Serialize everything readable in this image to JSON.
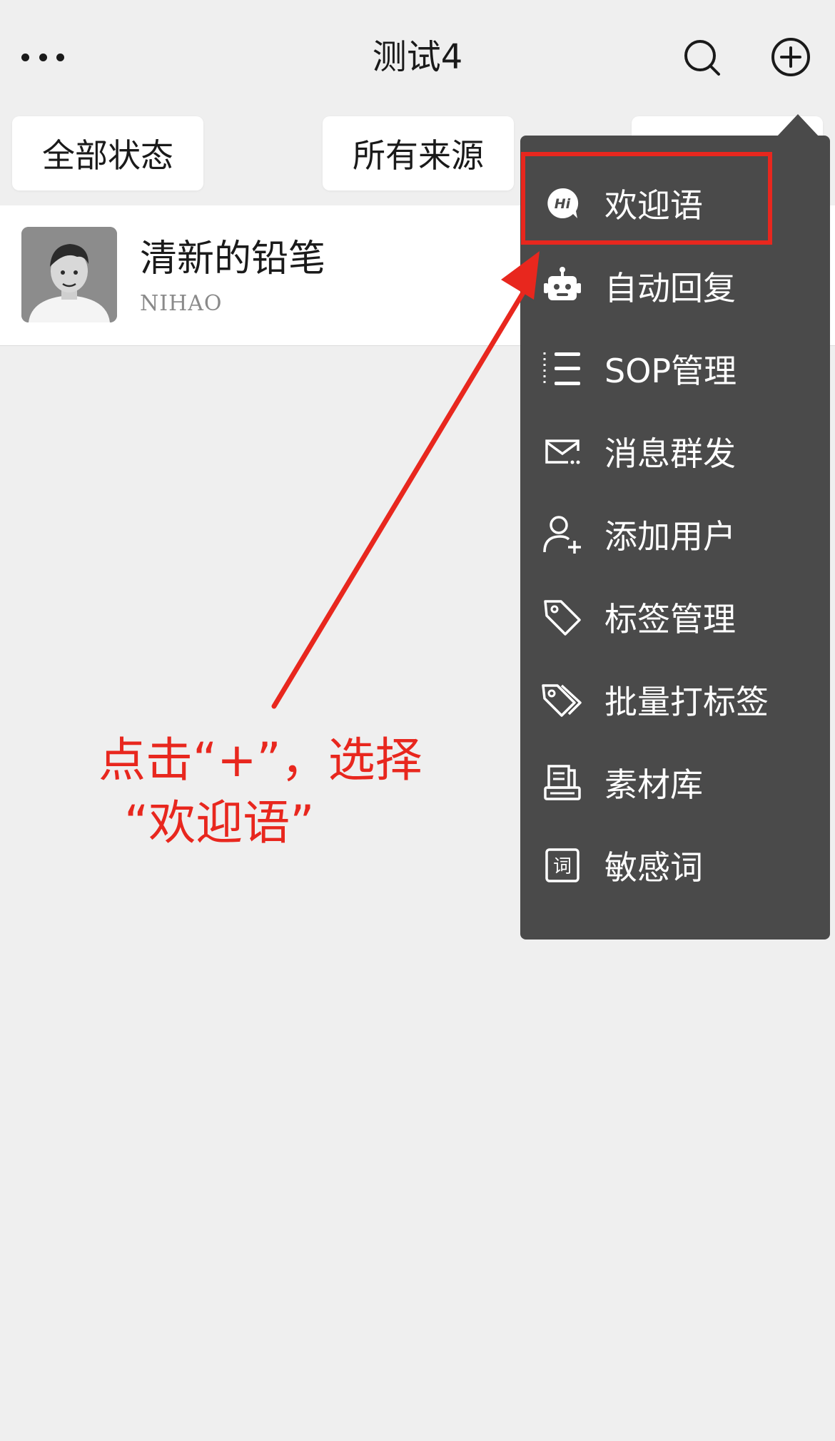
{
  "header": {
    "title": "测试4",
    "more_icon": "more-dots-icon",
    "search_icon": "search-icon",
    "add_icon": "plus-circle-icon"
  },
  "filters": [
    "全部状态",
    "所有来源",
    ""
  ],
  "contact": {
    "name": "清新的铅笔",
    "subtitle": "NIHAO",
    "avatar_icon": "avatar"
  },
  "menu": {
    "items": [
      {
        "label": "欢迎语",
        "icon": "hi-bubble-icon"
      },
      {
        "label": "自动回复",
        "icon": "robot-icon"
      },
      {
        "label": "SOP管理",
        "icon": "list-icon"
      },
      {
        "label": "消息群发",
        "icon": "mail-broadcast-icon"
      },
      {
        "label": "添加用户",
        "icon": "add-user-icon"
      },
      {
        "label": "标签管理",
        "icon": "tag-icon"
      },
      {
        "label": "批量打标签",
        "icon": "multi-tag-icon"
      },
      {
        "label": "素材库",
        "icon": "material-library-icon"
      },
      {
        "label": "敏感词",
        "icon": "sensitive-word-icon"
      }
    ]
  },
  "annotation": {
    "line1": "点击“+”，选择",
    "line2": "“欢迎语”",
    "color": "#e8271e"
  },
  "colors": {
    "menu_bg": "#4a4a4a",
    "page_bg": "#efefef",
    "accent_red": "#e8271e"
  }
}
